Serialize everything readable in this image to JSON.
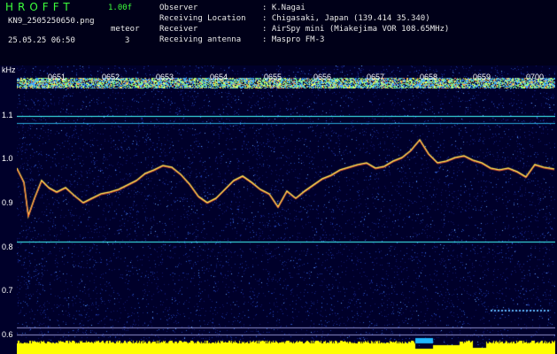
{
  "header": {
    "app_name": "HROFFT",
    "version": "1.00f",
    "file_name": "KN9_2505250650.png",
    "datetime": "25.05.25 06:50",
    "meteor_label": "meteor",
    "meteor_count": "3",
    "fields": [
      {
        "label": "Observer",
        "value": ": K.Nagai"
      },
      {
        "label": "Receiving Location",
        "value": ": Chigasaki, Japan (139.414 35.340)"
      },
      {
        "label": "Receiver",
        "value": ": AirSpy mini (Miakejima VOR 108.65MHz)"
      },
      {
        "label": "Receiving antenna",
        "value": ": Maspro FM-3"
      }
    ]
  },
  "axes": {
    "y_unit": "kHz",
    "y_ticks": [
      "1.1",
      "1.0",
      "0.9",
      "0.8",
      "0.7",
      "0.6"
    ],
    "x_ticks": [
      "0651",
      "0652",
      "0653",
      "0654",
      "0655",
      "0656",
      "0657",
      "0658",
      "0659",
      "0700"
    ]
  },
  "colors": {
    "background": "#00002a",
    "trace": "#ffee55",
    "line": "#40ffff",
    "noise_bar": "#ffff00"
  }
}
